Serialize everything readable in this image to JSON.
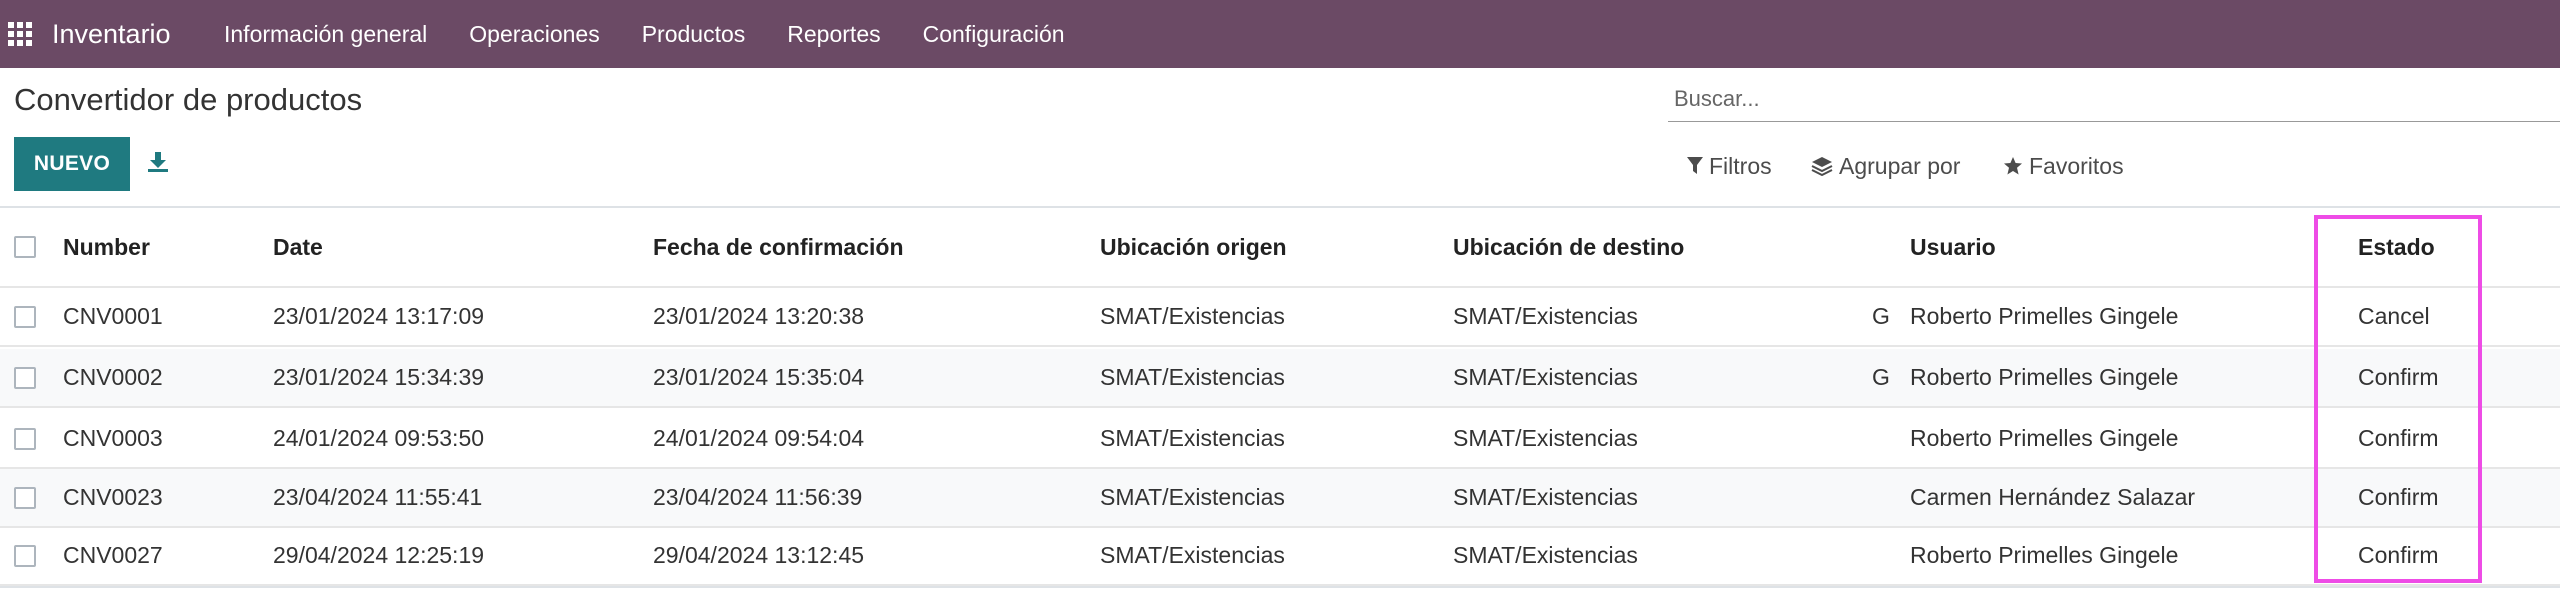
{
  "navbar": {
    "app_name": "Inventario",
    "menu": [
      "Información general",
      "Operaciones",
      "Productos",
      "Reportes",
      "Configuración"
    ],
    "background_color": "#6b4a65"
  },
  "control_panel": {
    "title": "Convertidor de productos",
    "new_button_label": "NUEVO",
    "search_placeholder": "Buscar...",
    "filters_label": "Filtros",
    "group_by_label": "Agrupar por",
    "favorites_label": "Favoritos",
    "accent_color": "#1f7a80"
  },
  "table": {
    "columns": [
      "Number",
      "Date",
      "Fecha de confirmación",
      "Ubicación origen",
      "Ubicación de destino",
      "Usuario",
      "Estado"
    ],
    "rows": [
      {
        "number": "CNV0001",
        "date": "23/01/2024 13:17:09",
        "confirm_date": "23/01/2024 13:20:38",
        "origin": "SMAT/Existencias",
        "destination": "SMAT/Existencias",
        "fragment": "G",
        "user": "Roberto Primelles Gingele",
        "state": "Cancel"
      },
      {
        "number": "CNV0002",
        "date": "23/01/2024 15:34:39",
        "confirm_date": "23/01/2024 15:35:04",
        "origin": "SMAT/Existencias",
        "destination": "SMAT/Existencias",
        "fragment": "G",
        "user": "Roberto Primelles Gingele",
        "state": "Confirm"
      },
      {
        "number": "CNV0003",
        "date": "24/01/2024 09:53:50",
        "confirm_date": "24/01/2024 09:54:04",
        "origin": "SMAT/Existencias",
        "destination": "SMAT/Existencias",
        "fragment": "",
        "user": "Roberto Primelles Gingele",
        "state": "Confirm"
      },
      {
        "number": "CNV0023",
        "date": "23/04/2024 11:55:41",
        "confirm_date": "23/04/2024 11:56:39",
        "origin": "SMAT/Existencias",
        "destination": "SMAT/Existencias",
        "fragment": "",
        "user": "Carmen Hernández Salazar",
        "state": "Confirm"
      },
      {
        "number": "CNV0027",
        "date": "29/04/2024 12:25:19",
        "confirm_date": "29/04/2024 13:12:45",
        "origin": "SMAT/Existencias",
        "destination": "SMAT/Existencias",
        "fragment": "",
        "user": "Roberto Primelles Gingele",
        "state": "Confirm"
      }
    ],
    "highlight_color": "#ee4ce6"
  }
}
